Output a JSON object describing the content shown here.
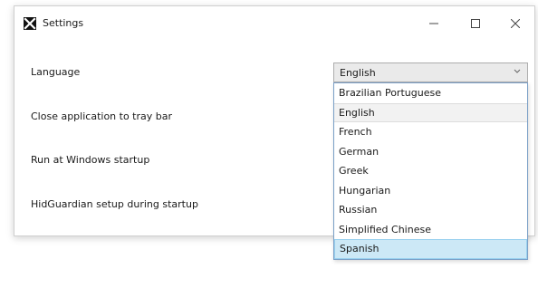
{
  "window": {
    "title": "Settings",
    "app_icon": "x-logo-icon",
    "controls": {
      "minimize": "minimize-icon",
      "maximize": "maximize-icon",
      "close": "close-icon"
    }
  },
  "settings": {
    "language_label": "Language",
    "close_to_tray_label": "Close application to tray bar",
    "run_at_startup_label": "Run at Windows startup",
    "hidguardian_label": "HidGuardian setup during startup"
  },
  "language_combo": {
    "selected": "English",
    "options": [
      "Brazilian Portuguese",
      "English",
      "French",
      "German",
      "Greek",
      "Hungarian",
      "Russian",
      "Simplified Chinese",
      "Spanish"
    ],
    "current_option": "English",
    "hovered_option": "Spanish"
  },
  "colors": {
    "hover_background": "#cce8f6",
    "dropdown_border": "#7a9fc7"
  }
}
